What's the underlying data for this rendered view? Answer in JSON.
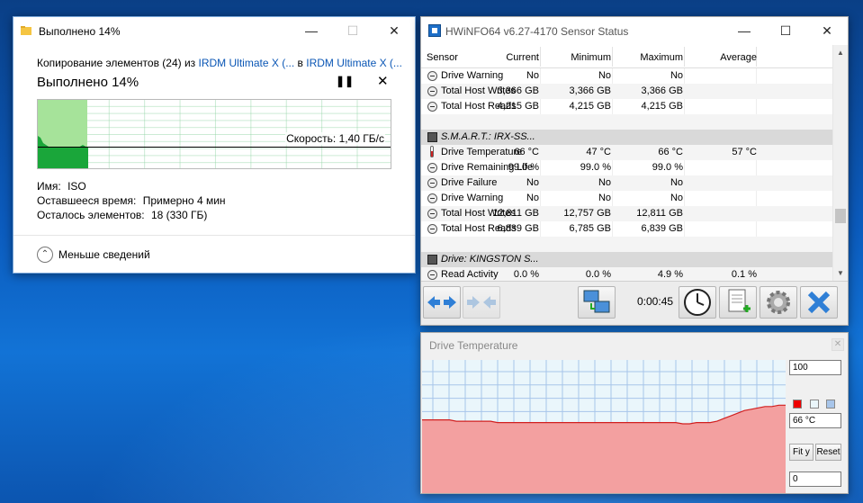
{
  "copy_dialog": {
    "title": "Выполнено 14%",
    "line_prefix": "Копирование элементов (24) из ",
    "source_link": "IRDM Ultimate X (...",
    "middle_word": " в ",
    "dest_link": "IRDM Ultimate X (...",
    "big_status": "Выполнено 14%",
    "progress_percent": 14,
    "speed": "Скорость: 1,40 ГБ/с",
    "name_label": "Имя:",
    "name_value": "ISO",
    "time_label": "Оставшееся время:",
    "time_value": "Примерно 4 мин",
    "items_label": "Осталось элементов:",
    "items_value": "18 (330 ГБ)",
    "less_details": "Меньше сведений",
    "pause_icon": "pause-icon",
    "stop_icon": "close-icon"
  },
  "hwinfo": {
    "title": "HWiNFO64 v6.27-4170 Sensor Status",
    "columns": {
      "sensor": "Sensor",
      "current": "Current",
      "minimum": "Minimum",
      "maximum": "Maximum",
      "average": "Average"
    },
    "rows": [
      {
        "type": "item",
        "icon": "gauge-icon",
        "name": "Drive Warning",
        "current": "No",
        "minimum": "No",
        "maximum": "No",
        "average": ""
      },
      {
        "type": "item",
        "icon": "gauge-icon",
        "name": "Total Host Writes",
        "current": "3,366 GB",
        "minimum": "3,366 GB",
        "maximum": "3,366 GB",
        "average": ""
      },
      {
        "type": "item",
        "icon": "gauge-icon",
        "name": "Total Host Reads",
        "current": "4,215 GB",
        "minimum": "4,215 GB",
        "maximum": "4,215 GB",
        "average": ""
      },
      {
        "type": "blank"
      },
      {
        "type": "section",
        "name": "S.M.A.R.T.: IRX-SS..."
      },
      {
        "type": "item",
        "icon": "thermometer-icon",
        "name": "Drive Temperature",
        "current": "66 °C",
        "minimum": "47 °C",
        "maximum": "66 °C",
        "average": "57 °C"
      },
      {
        "type": "item",
        "icon": "gauge-icon",
        "name": "Drive Remaining Life",
        "current": "99.0 %",
        "minimum": "99.0 %",
        "maximum": "99.0 %",
        "average": ""
      },
      {
        "type": "item",
        "icon": "gauge-icon",
        "name": "Drive Failure",
        "current": "No",
        "minimum": "No",
        "maximum": "No",
        "average": ""
      },
      {
        "type": "item",
        "icon": "gauge-icon",
        "name": "Drive Warning",
        "current": "No",
        "minimum": "No",
        "maximum": "No",
        "average": ""
      },
      {
        "type": "item",
        "icon": "gauge-icon",
        "name": "Total Host Writes",
        "current": "12,811 GB",
        "minimum": "12,757 GB",
        "maximum": "12,811 GB",
        "average": ""
      },
      {
        "type": "item",
        "icon": "gauge-icon",
        "name": "Total Host Reads",
        "current": "6,839 GB",
        "minimum": "6,785 GB",
        "maximum": "6,839 GB",
        "average": ""
      },
      {
        "type": "blank"
      },
      {
        "type": "section",
        "name": "Drive: KINGSTON S..."
      },
      {
        "type": "item",
        "icon": "gauge-icon",
        "name": "Read Activity",
        "current": "0.0 %",
        "minimum": "0.0 %",
        "maximum": "4.9 %",
        "average": "0.1 %"
      }
    ],
    "elapsed_time": "0:00:45",
    "toolbar_icons": [
      "arrows-left-right-icon",
      "arrows-disabled-icon",
      "network-icon",
      "clock-icon",
      "report-add-icon",
      "settings-gear-icon",
      "close-x-icon"
    ]
  },
  "graph": {
    "title": "Drive Temperature",
    "max_value": "100",
    "current_value": "66 °C",
    "min_value": "0",
    "fit_label": "Fit y",
    "reset_label": "Reset",
    "swatch_colors": [
      "#ee0000",
      "#eaf6fb",
      "#a7c5ea"
    ],
    "series_color": "#f3a0a0",
    "line_color": "#d12020",
    "ylim": [
      0,
      100
    ],
    "history": [
      55,
      55,
      55,
      55,
      55,
      54,
      54,
      54,
      54,
      54,
      54,
      53,
      53,
      53,
      53,
      53,
      53,
      53,
      53,
      53,
      53,
      53,
      53,
      53,
      53,
      53,
      53,
      53,
      53,
      53,
      53,
      53,
      53,
      53,
      53,
      53,
      53,
      53,
      52,
      52,
      53,
      53,
      53,
      54,
      56,
      58,
      60,
      62,
      63,
      64,
      65,
      65,
      66,
      66
    ]
  }
}
